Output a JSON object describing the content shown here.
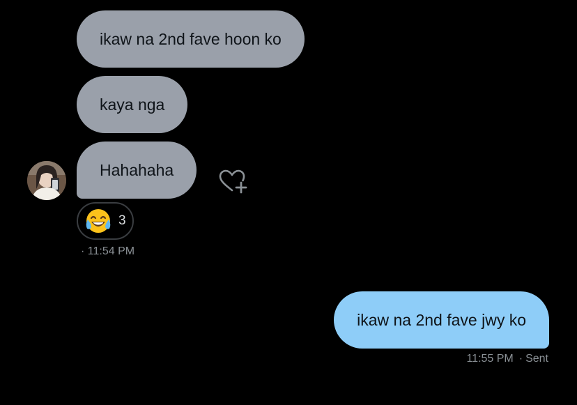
{
  "conversation": {
    "incoming": [
      {
        "text": "ikaw na 2nd fave hoon ko"
      },
      {
        "text": "kaya nga"
      },
      {
        "text": "Hahahaha"
      }
    ],
    "reaction": {
      "emoji_icon": "face-with-tears-of-joy-icon",
      "count": "3"
    },
    "incoming_time": "· 11:54 PM",
    "outgoing": {
      "text": "ikaw na 2nd fave jwy ko"
    },
    "outgoing_time": "11:55 PM",
    "outgoing_status": "Sent",
    "separator": "·"
  },
  "colors": {
    "background": "#000000",
    "incoming_bubble": "#9aa0aa",
    "outgoing_bubble": "#8ecdf8",
    "meta_text": "#8b9196"
  }
}
